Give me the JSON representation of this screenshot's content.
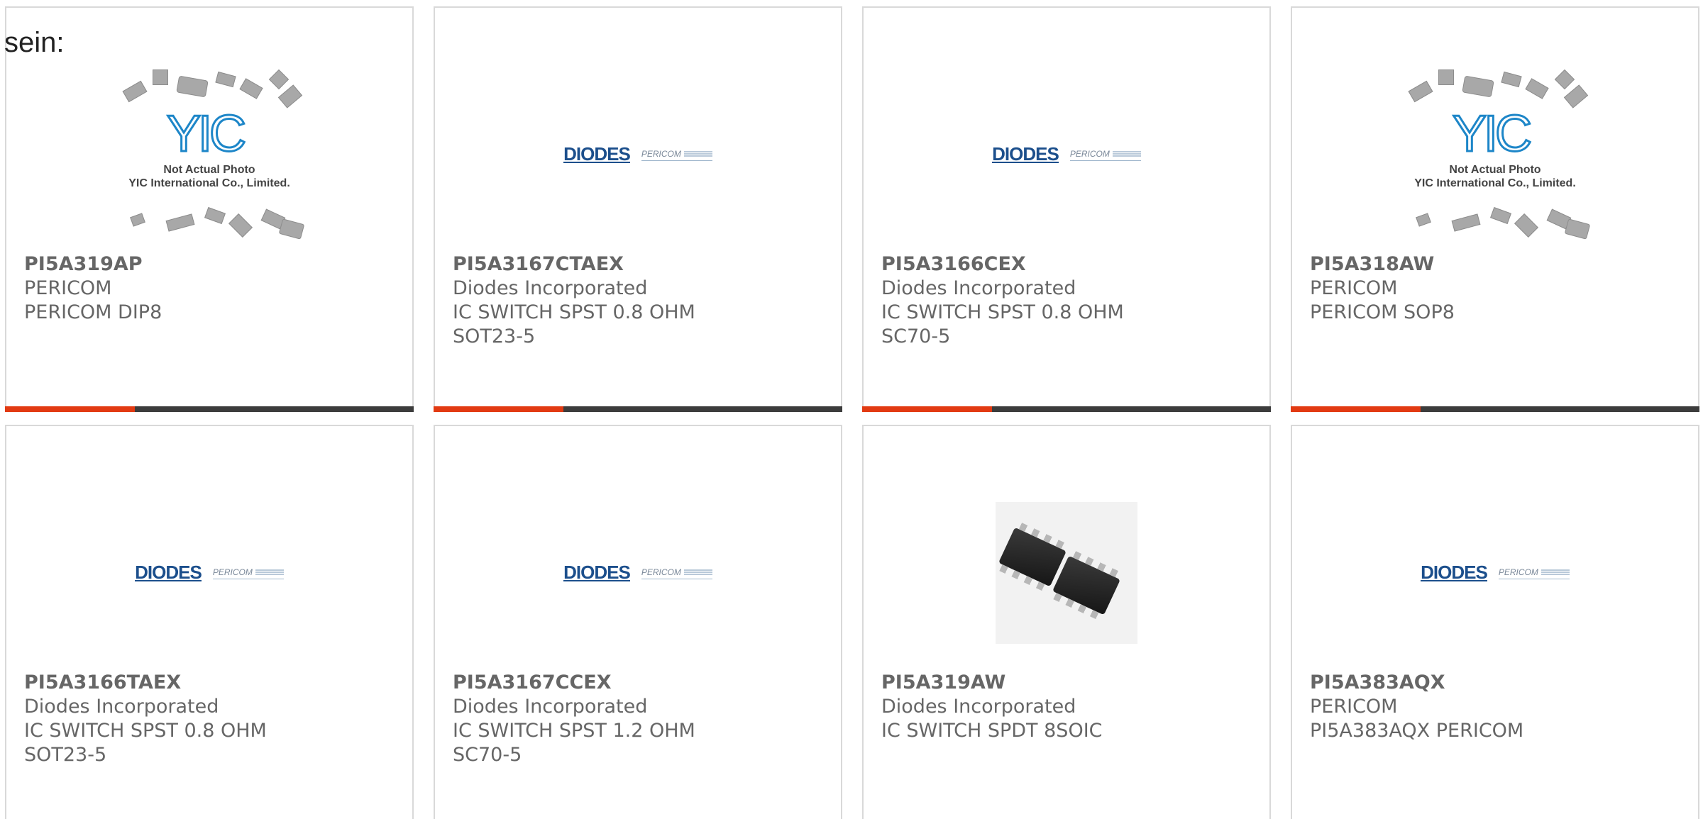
{
  "top_text": "sein:",
  "image_text": {
    "yic_letters": "YIC",
    "yic_line1": "Not Actual Photo",
    "yic_line2": "YIC International Co., Limited.",
    "diodes_brand": "DIODES",
    "pericom_brand": "PERICOM"
  },
  "colors": {
    "accent": "#e23a12",
    "bar": "#3c3c3c",
    "text": "#666666",
    "border": "#d9d9d9"
  },
  "products": [
    {
      "part": "PI5A319AP",
      "manufacturer": "PERICOM",
      "description": "PERICOM DIP8",
      "image": "yic-placeholder"
    },
    {
      "part": "PI5A3167CTAEX",
      "manufacturer": "Diodes Incorporated",
      "description": "IC SWITCH SPST 0.8 OHM SOT23-5",
      "image": "diodes-logo"
    },
    {
      "part": "PI5A3166CEX",
      "manufacturer": "Diodes Incorporated",
      "description": "IC SWITCH SPST 0.8 OHM SC70-5",
      "image": "diodes-logo"
    },
    {
      "part": "PI5A318AW",
      "manufacturer": "PERICOM",
      "description": "PERICOM SOP8",
      "image": "yic-placeholder"
    },
    {
      "part": "PI5A3166TAEX",
      "manufacturer": "Diodes Incorporated",
      "description": "IC SWITCH SPST 0.8 OHM SOT23-5",
      "image": "diodes-logo"
    },
    {
      "part": "PI5A3167CCEX",
      "manufacturer": "Diodes Incorporated",
      "description": "IC SWITCH SPST 1.2 OHM SC70-5",
      "image": "diodes-logo"
    },
    {
      "part": "PI5A319AW",
      "manufacturer": "Diodes Incorporated",
      "description": "IC SWITCH SPDT 8SOIC",
      "image": "soic-photo"
    },
    {
      "part": "PI5A383AQX",
      "manufacturer": "PERICOM",
      "description": "PI5A383AQX PERICOM",
      "image": "diodes-logo"
    }
  ]
}
